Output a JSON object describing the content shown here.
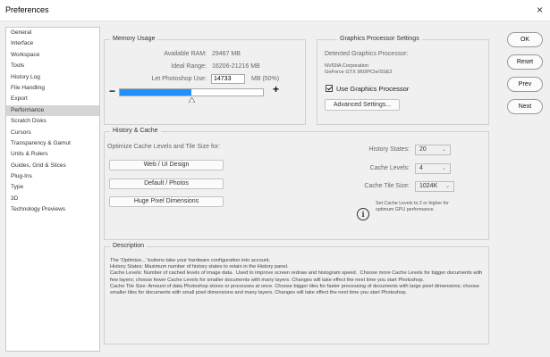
{
  "window": {
    "title": "Preferences",
    "close_glyph": "×"
  },
  "sidebar": {
    "active_index": 7,
    "items": [
      {
        "label": "General"
      },
      {
        "label": "Interface"
      },
      {
        "label": "Workspace"
      },
      {
        "label": "Tools"
      },
      {
        "label": "History Log"
      },
      {
        "label": "File Handling"
      },
      {
        "label": "Export"
      },
      {
        "label": "Performance"
      },
      {
        "label": "Scratch Disks"
      },
      {
        "label": "Cursors"
      },
      {
        "label": "Transparency & Gamut"
      },
      {
        "label": "Units & Rulers"
      },
      {
        "label": "Guides, Grid & Slices"
      },
      {
        "label": "Plug-Ins"
      },
      {
        "label": "Type"
      },
      {
        "label": "3D"
      },
      {
        "label": "Technology Previews"
      }
    ]
  },
  "memory": {
    "legend": "Memory Usage",
    "available_label": "Available RAM:",
    "available_value": "29467 MB",
    "ideal_label": "Ideal Range:",
    "ideal_value": "16206-21216 MB",
    "let_label": "Let Photoshop Use:",
    "let_value": "14733",
    "let_suffix": "MB (50%)",
    "slider_fraction": 0.5,
    "minus": "−",
    "plus": "+"
  },
  "gpu": {
    "legend": "Graphics Processor Settings",
    "detected_label": "Detected Graphics Processor:",
    "vendor": "NVIDIA Corporation",
    "model": "GeForce GTX 960/PCIe/SSE2",
    "use_label": "Use Graphics Processor",
    "use_checked": true,
    "advanced_button": "Advanced Settings..."
  },
  "history_cache": {
    "legend": "History & Cache",
    "optimize_label": "Optimize Cache Levels and Tile Size for:",
    "buttons": [
      "Web / UI Design",
      "Default / Photos",
      "Huge Pixel Dimensions"
    ],
    "history_states_label": "History States:",
    "history_states_value": "20",
    "cache_levels_label": "Cache Levels:",
    "cache_levels_value": "4",
    "tile_size_label": "Cache Tile Size:",
    "tile_size_value": "1024K",
    "info_note": "Set Cache Levels to 2 or higher for optimum GPU performance.",
    "info_glyph": "i",
    "caret": "⌄"
  },
  "description": {
    "legend": "Description",
    "text": "The 'Optimize...' buttons take your hardware configuration into account.\nHistory States: Maximum number of history states to retain in the History panel.\nCache Levels: Number of cached levels of image data.  Used to improve screen redraw and histogram speed.  Choose more Cache Levels for bigger documents with few layers; choose fewer Cache Levels for smaller documents with many layers. Changes will take effect the next time you start Photoshop.\nCache Tile Size: Amount of data Photoshop stores or processes at once. Choose bigger tiles for faster processing of documents with large pixel dimensions; choose smaller tiles for documents with small pixel dimensions and many layers. Changes will take effect the next time you start Photoshop."
  },
  "actions": {
    "ok": "OK",
    "reset": "Reset",
    "prev": "Prev",
    "next": "Next"
  },
  "colors": {
    "accent": "#1e90ff",
    "selected_row": "#d5d5d5"
  }
}
